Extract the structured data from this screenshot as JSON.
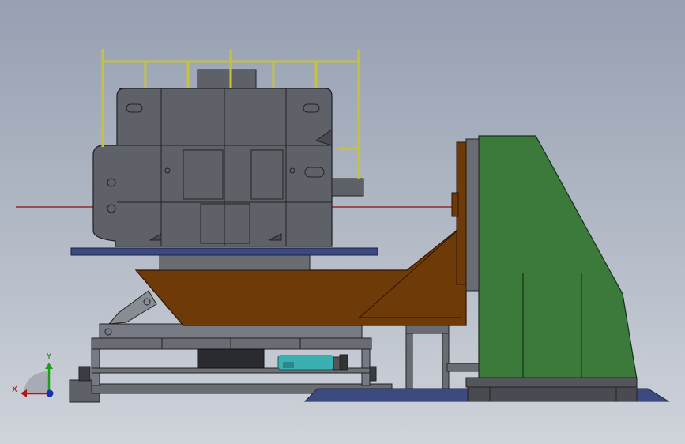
{
  "triad": {
    "x_label": "X",
    "y_label": "Y"
  },
  "colors": {
    "background_top": "#96a0b2",
    "background_bottom": "#cfd3da",
    "workpiece": "#5f6168",
    "railing": "#c8c23a",
    "tilt_table": "#6e3a08",
    "headstock": "#3c7a3c",
    "base_plate": "#3c4a80",
    "frame": "#5f6168",
    "motor": "#3ab0b0",
    "center_line": "#8a1010",
    "axis_x": "#b01818",
    "axis_y": "#18a018",
    "axis_z": "#1a2fb0"
  },
  "components": [
    "workpiece",
    "railing",
    "turntable-plate",
    "tilt-table",
    "headstock-column",
    "base-plate",
    "lift-frame",
    "motor"
  ]
}
